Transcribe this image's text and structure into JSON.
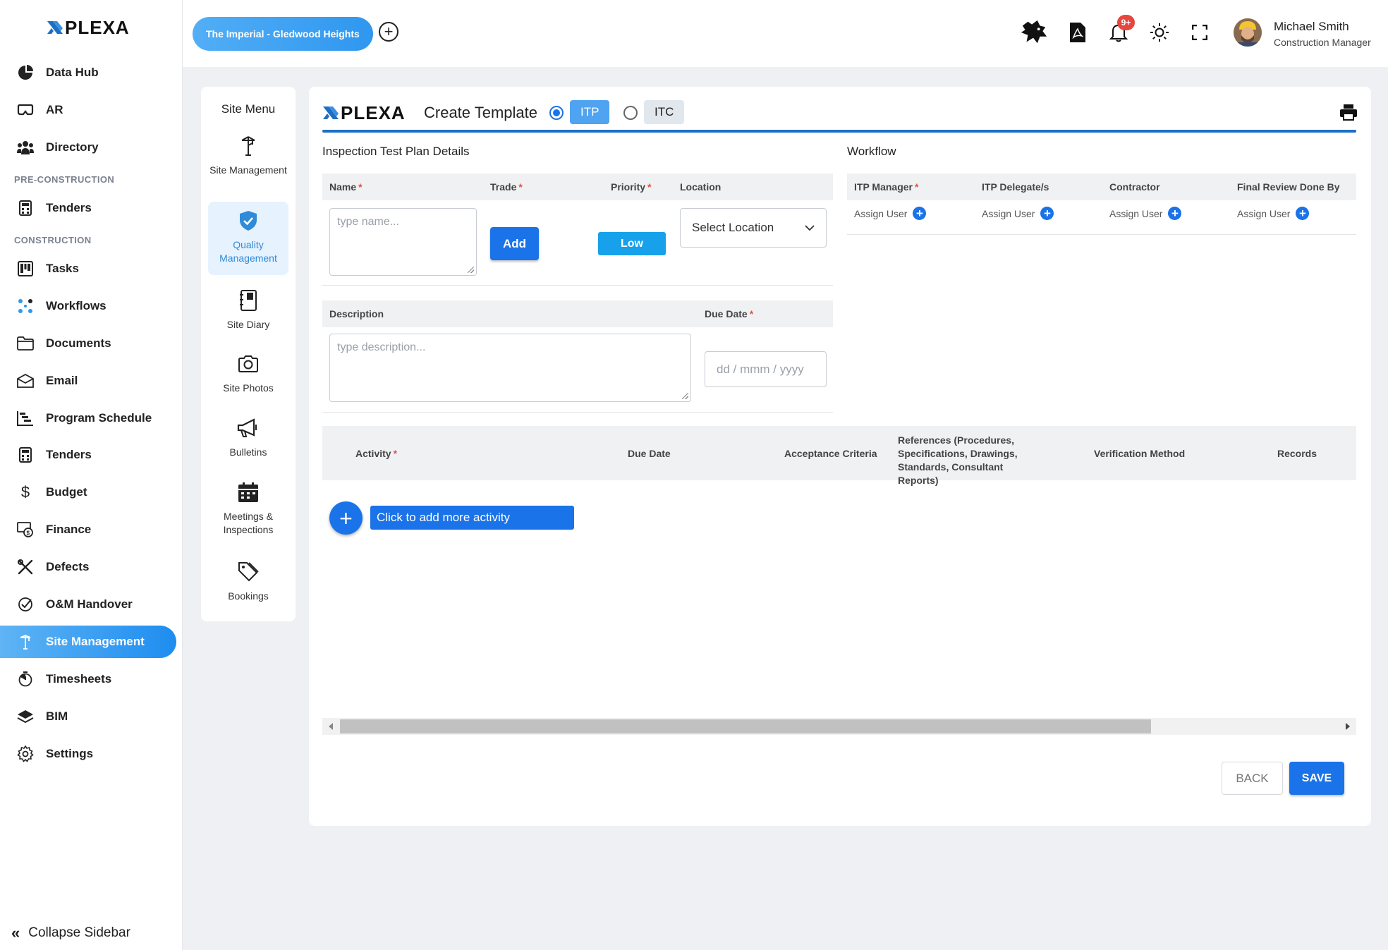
{
  "brand": {
    "logo_text": "PLEXA",
    "accent": "#1a73e8"
  },
  "sidebar": {
    "items": [
      {
        "label": "Data Hub",
        "icon": "pie-chart-icon"
      },
      {
        "label": "AR",
        "icon": "vr-headset-icon"
      },
      {
        "label": "Directory",
        "icon": "people-icon"
      },
      {
        "label": "Tenders",
        "icon": "calculator-icon"
      },
      {
        "label": "Tasks",
        "icon": "kanban-icon"
      },
      {
        "label": "Workflows",
        "icon": "workflow-icon"
      },
      {
        "label": "Documents",
        "icon": "folder-icon"
      },
      {
        "label": "Email",
        "icon": "envelope-icon"
      },
      {
        "label": "Program Schedule",
        "icon": "gantt-icon"
      },
      {
        "label": "Tenders",
        "icon": "calculator-icon"
      },
      {
        "label": "Budget",
        "icon": "dollar-icon"
      },
      {
        "label": "Finance",
        "icon": "finance-icon"
      },
      {
        "label": "Defects",
        "icon": "tools-icon"
      },
      {
        "label": "O&M Handover",
        "icon": "check-circle-icon"
      },
      {
        "label": "Site Management",
        "icon": "crane-icon"
      },
      {
        "label": "Timesheets",
        "icon": "stopwatch-icon"
      },
      {
        "label": "BIM",
        "icon": "layers-icon"
      },
      {
        "label": "Settings",
        "icon": "gear-icon"
      }
    ],
    "sections": [
      "PRE-CONSTRUCTION",
      "CONSTRUCTION"
    ],
    "collapse_label": "Collapse Sidebar"
  },
  "header": {
    "project": "The Imperial - Gledwood Heights",
    "notification_badge": "9+",
    "user_name": "Michael Smith",
    "user_role": "Construction Manager"
  },
  "site_menu": {
    "title": "Site Menu",
    "items": [
      {
        "label": "Site Management",
        "icon": "crane-icon"
      },
      {
        "label": "Quality Management",
        "icon": "shield-check-icon"
      },
      {
        "label": "Site Diary",
        "icon": "diary-icon"
      },
      {
        "label": "Site Photos",
        "icon": "camera-icon"
      },
      {
        "label": "Bulletins",
        "icon": "megaphone-icon"
      },
      {
        "label": "Meetings & Inspections",
        "icon": "calendar-icon"
      },
      {
        "label": "Bookings",
        "icon": "tags-icon"
      }
    ]
  },
  "form": {
    "title": "Create Template",
    "types": [
      "ITP",
      "ITC"
    ],
    "itp_section": "Inspection Test Plan Details",
    "workflow_section": "Workflow",
    "fields": {
      "name": "Name",
      "trade": "Trade",
      "priority": "Priority",
      "location": "Location",
      "description": "Description",
      "due_date": "Due Date"
    },
    "name_placeholder": "type name...",
    "add_label": "Add",
    "priority_value": "Low",
    "location_placeholder": "Select Location",
    "description_placeholder": "type description...",
    "date_placeholder": "dd / mmm / yyyy",
    "required_mark": "*",
    "workflow_cols": [
      "ITP Manager",
      "ITP Delegate/s",
      "Contractor",
      "Final Review Done By"
    ],
    "assign_label": "Assign User",
    "activity_cols": {
      "activity": "Activity",
      "due_date": "Due Date",
      "acceptance": "Acceptance Criteria",
      "references": "References (Procedures, Specifications, Drawings, Standards, Consultant Reports)",
      "verification": "Verification Method",
      "records": "Records"
    },
    "add_activity_label": "Click to add more activity",
    "back_label": "BACK",
    "save_label": "SAVE"
  }
}
